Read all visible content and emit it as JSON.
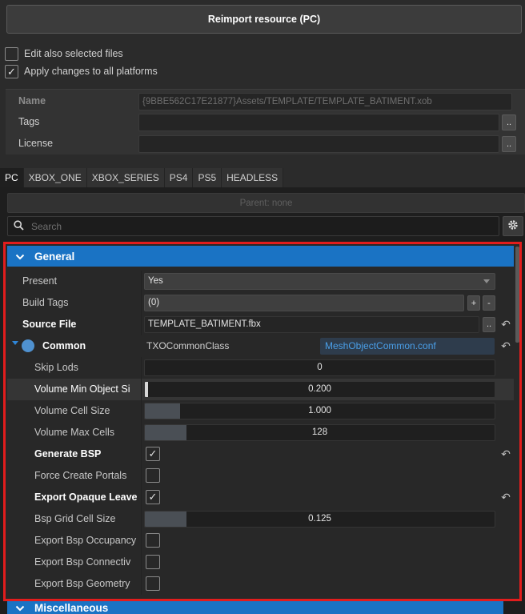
{
  "reimport_label": "Reimport resource (PC)",
  "options": {
    "edit_selected": {
      "label": "Edit also selected files",
      "checked": false
    },
    "apply_all": {
      "label": "Apply changes to all platforms",
      "checked": true
    }
  },
  "meta": {
    "name_label": "Name",
    "name_value": "{9BBE562C17E21877}Assets/TEMPLATE/TEMPLATE_BATIMENT.xob",
    "tags_label": "Tags",
    "tags_value": "",
    "license_label": "License",
    "license_value": "",
    "dots": ".."
  },
  "tabs": [
    "PC",
    "XBOX_ONE",
    "XBOX_SERIES",
    "PS4",
    "PS5",
    "HEADLESS"
  ],
  "parent": "Parent: none",
  "search_placeholder": "Search",
  "general": {
    "title": "General",
    "present": {
      "label": "Present",
      "value": "Yes"
    },
    "build_tags": {
      "label": "Build Tags",
      "value": "(0)",
      "add": "+",
      "remove": "-"
    },
    "source_file": {
      "label": "Source File",
      "value": "TEMPLATE_BATIMENT.fbx"
    },
    "common": {
      "label": "Common",
      "class": "TXOCommonClass",
      "link": "MeshObjectCommon.conf"
    },
    "skip_lods": {
      "label": "Skip Lods",
      "value": "0",
      "fill": 0
    },
    "vol_min": {
      "label": "Volume Min Object Si",
      "value": "0.200",
      "fill": 0.01
    },
    "vol_cell": {
      "label": "Volume Cell Size",
      "value": "1.000",
      "fill": 0.1
    },
    "vol_max": {
      "label": "Volume Max Cells",
      "value": "128",
      "fill": 0.12
    },
    "gen_bsp": {
      "label": "Generate BSP",
      "checked": true
    },
    "force_portals": {
      "label": "Force Create Portals",
      "checked": false
    },
    "export_opaque": {
      "label": "Export Opaque Leave",
      "checked": true
    },
    "bsp_grid": {
      "label": "Bsp Grid Cell Size",
      "value": "0.125",
      "fill": 0.12
    },
    "bsp_occ": {
      "label": "Export Bsp Occupancy",
      "checked": false
    },
    "bsp_conn": {
      "label": "Export Bsp Connectiv",
      "checked": false
    },
    "bsp_geom": {
      "label": "Export Bsp Geometry",
      "checked": false
    }
  },
  "misc_title": "Miscellaneous"
}
